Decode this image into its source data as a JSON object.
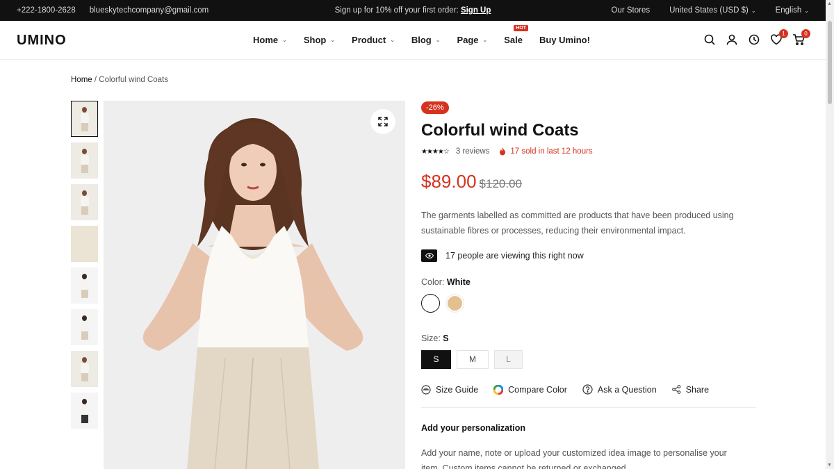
{
  "topbar": {
    "phone": "+222-1800-2628",
    "email": "blueskytechcompany@gmail.com",
    "promo_text": "Sign up for 10% off your first order:",
    "promo_link": "Sign Up",
    "stores": "Our Stores",
    "currency": "United States (USD $)",
    "language": "English"
  },
  "header": {
    "logo": "UMINO",
    "nav": [
      "Home",
      "Shop",
      "Product",
      "Blog",
      "Page",
      "Sale",
      "Buy Umino!"
    ],
    "hot_badge": "HOT",
    "wishlist_count": "1",
    "cart_count": "0"
  },
  "breadcrumb": {
    "home": "Home",
    "separator": "/",
    "current": "Colorful wind Coats"
  },
  "product": {
    "discount": "-26%",
    "title": "Colorful wind Coats",
    "reviews": "3 reviews",
    "sold": "17 sold in last 12 hours",
    "price": "$89.00",
    "old_price": "$120.00",
    "description": "The garments labelled as committed are products that have been produced using sustainable fibres or processes, reducing their environmental impact.",
    "viewing": "17 people are viewing this right now",
    "color_label": "Color:",
    "color_value": "White",
    "size_label": "Size:",
    "size_value": "S",
    "sizes": [
      "S",
      "M",
      "L"
    ],
    "actions": [
      "Size Guide",
      "Compare Color",
      "Ask a Question",
      "Share"
    ],
    "personalization_title": "Add your personalization",
    "personalization_text": "Add your name, note or upload your customized idea image to personalise your item. Custom items cannot be returned or exchanged."
  },
  "colors": {
    "accent": "#d6321f",
    "dark": "#111111",
    "beige_swatch": "#e3c08e"
  },
  "icons": {
    "header": [
      "search-icon",
      "user-icon",
      "clock-icon",
      "heart-icon",
      "cart-icon"
    ],
    "expand": "expand-icon",
    "eye": "eye-icon",
    "fire": "fire-icon"
  }
}
